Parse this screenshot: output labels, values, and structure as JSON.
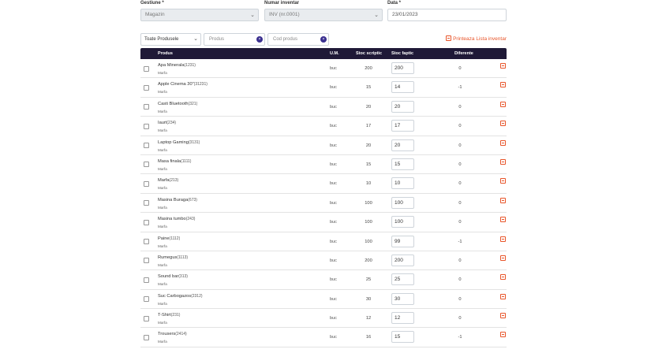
{
  "form": {
    "gestiune": {
      "label": "Gestiune *",
      "value": "Magazin"
    },
    "numar": {
      "label": "Numar inventar",
      "value": "INV (nr.0001)"
    },
    "data": {
      "label": "Data *",
      "value": "23/01/2023"
    }
  },
  "filters": {
    "category_select": "Toate Produsele",
    "product_placeholder": "Produs",
    "code_placeholder": "Cod produs",
    "print_label": "Printeaza Lista inventar"
  },
  "table": {
    "headers": {
      "product": "Produs",
      "um": "U.M.",
      "scriptic": "Stoc scriptic",
      "faptic": "Stoc faptic",
      "diferente": "Diferente"
    },
    "rows": [
      {
        "name": "Apa Minerala",
        "code": "(1231)",
        "category": "Marfa",
        "um": "buc",
        "scriptic": "200",
        "faptic": "200",
        "diff": "0"
      },
      {
        "name": "Apple Cinema 30\"",
        "code": "(31231)",
        "category": "Marfa",
        "um": "buc",
        "scriptic": "15",
        "faptic": "14",
        "diff": "-1"
      },
      {
        "name": "Casti Bluetooth",
        "code": "(321)",
        "category": "Marfa",
        "um": "buc",
        "scriptic": "20",
        "faptic": "20",
        "diff": "0"
      },
      {
        "name": "Iaurt",
        "code": "(234)",
        "category": "Marfa",
        "um": "buc",
        "scriptic": "17",
        "faptic": "17",
        "diff": "0"
      },
      {
        "name": "Laptop Gaming",
        "code": "(3131)",
        "category": "Marfa",
        "um": "buc",
        "scriptic": "20",
        "faptic": "20",
        "diff": "0"
      },
      {
        "name": "Masa finala",
        "code": "(1111)",
        "category": "Marfa",
        "um": "buc",
        "scriptic": "15",
        "faptic": "15",
        "diff": "0"
      },
      {
        "name": "Marfa",
        "code": "(213)",
        "category": "Marfa",
        "um": "buc",
        "scriptic": "10",
        "faptic": "10",
        "diff": "0"
      },
      {
        "name": "Masina Buraga",
        "code": "(673)",
        "category": "Marfa",
        "um": "buc",
        "scriptic": "100",
        "faptic": "100",
        "diff": "0"
      },
      {
        "name": "Masina tumbo",
        "code": "(243)",
        "category": "Marfa",
        "um": "buc",
        "scriptic": "100",
        "faptic": "100",
        "diff": "0"
      },
      {
        "name": "Paine",
        "code": "(1112)",
        "category": "Marfa",
        "um": "buc",
        "scriptic": "100",
        "faptic": "99",
        "diff": "-1"
      },
      {
        "name": "Rumegus",
        "code": "(1113)",
        "category": "Marfa",
        "um": "buc",
        "scriptic": "200",
        "faptic": "200",
        "diff": "0"
      },
      {
        "name": "Sound bar",
        "code": "(313)",
        "category": "Marfa",
        "um": "buc",
        "scriptic": "25",
        "faptic": "25",
        "diff": "0"
      },
      {
        "name": "Suc Carbogazos",
        "code": "(2312)",
        "category": "Marfa",
        "um": "buc",
        "scriptic": "30",
        "faptic": "30",
        "diff": "0"
      },
      {
        "name": "T-Shirt",
        "code": "(231)",
        "category": "Marfa",
        "um": "buc",
        "scriptic": "12",
        "faptic": "12",
        "diff": "0"
      },
      {
        "name": "Trousers",
        "code": "(2414)",
        "category": "Marfa",
        "um": "buc",
        "scriptic": "16",
        "faptic": "15",
        "diff": "-1"
      }
    ]
  },
  "colors": {
    "header_bg": "#1f1937",
    "accent": "#e8552a",
    "clear_icon": "#3a2f8f"
  }
}
